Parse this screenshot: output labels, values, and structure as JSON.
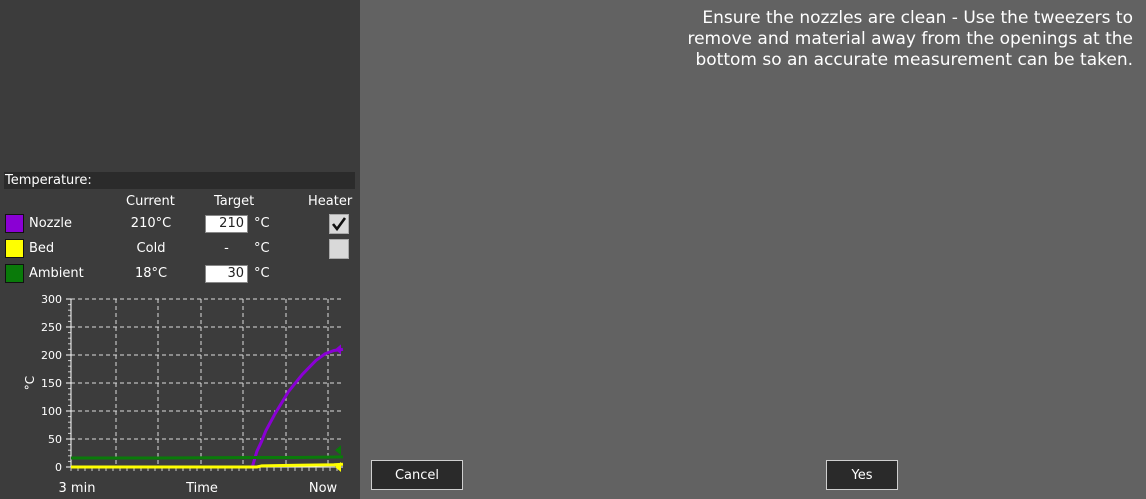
{
  "instruction": "Ensure the nozzles are clean - Use the tweezers to remove and material away from the openings at the bottom so an accurate measurement can be taken.",
  "temperature": {
    "header": "Temperature:",
    "columns": {
      "current": "Current",
      "target": "Target",
      "heater": "Heater"
    },
    "unit": "°C",
    "rows": [
      {
        "label": "Nozzle",
        "color": "#8a00d4",
        "current": "210°C",
        "target": "210",
        "heater_on": true
      },
      {
        "label": "Bed",
        "color": "#ffff00",
        "current": "Cold",
        "target": "-",
        "heater_on": false
      },
      {
        "label": "Ambient",
        "color": "#0a7a0a",
        "current": "18°C",
        "target": "30",
        "heater_on": null
      }
    ]
  },
  "chart_data": {
    "type": "line",
    "ylabel": "°C",
    "ylim": [
      0,
      300
    ],
    "yticks": [
      0,
      50,
      100,
      150,
      200,
      250,
      300
    ],
    "xlabels": [
      "3 min",
      "Time",
      "Now"
    ],
    "xlim": [
      0,
      60
    ],
    "series": [
      {
        "name": "Nozzle",
        "color": "#8a00d4",
        "x": [
          0,
          10,
          20,
          30,
          40,
          41,
          42,
          43,
          45,
          48,
          51,
          54,
          56,
          58,
          60
        ],
        "y": [
          0,
          0,
          0,
          0,
          0,
          28,
          45,
          65,
          95,
          135,
          165,
          190,
          202,
          208,
          210
        ]
      },
      {
        "name": "Bed",
        "color": "#ffff00",
        "x": [
          0,
          41,
          42,
          50,
          58,
          60
        ],
        "y": [
          0,
          0,
          2,
          3,
          4,
          5
        ]
      },
      {
        "name": "Ambient",
        "color": "#0a7a0a",
        "x": [
          0,
          20,
          40,
          50,
          60
        ],
        "y": [
          16,
          16,
          17,
          17,
          18
        ]
      }
    ],
    "target_markers": [
      {
        "series": "Nozzle",
        "value": 210,
        "color": "#8a00d4"
      },
      {
        "series": "Ambient",
        "value": 30,
        "color": "#0a7a0a"
      },
      {
        "series": "Bed",
        "value": 0,
        "color": "#ffff00"
      }
    ]
  },
  "buttons": {
    "cancel": "Cancel",
    "yes": "Yes"
  }
}
